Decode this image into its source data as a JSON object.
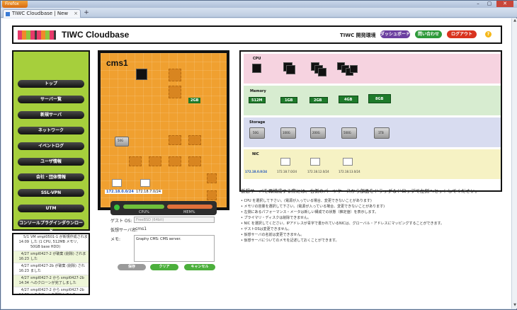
{
  "browser": {
    "app_button": "Firefox",
    "tab_title": "TIWC Cloudbase | New Server",
    "new_tab": "+",
    "controls": [
      "–",
      "▢",
      "✕"
    ]
  },
  "header": {
    "title": "TIWC Cloudbase",
    "env_label": "TIWC 開発環境",
    "buttons": [
      {
        "label": "ダッシュボード",
        "color": "#6b3fa0"
      },
      {
        "label": "問い合わせ",
        "color": "#2e9a3a"
      },
      {
        "label": "ログアウト",
        "color": "#d9331f"
      }
    ],
    "help": "?"
  },
  "nav": {
    "items": [
      "トップ",
      "サーバー覧",
      "新規サーバ",
      "ネットワーク",
      "イベントログ",
      "ユーザ情報",
      "会社・団体情報",
      "SSL-VPN",
      "UTM",
      "コンソールプラグインダウンロード"
    ]
  },
  "log": {
    "rows": [
      {
        "time": "5/1 14:09",
        "link": "smpl0501-1",
        "text": "VM smpl0501-1 が新規作成されました (1 CPU, 512MB メモリ, 50GB base HDD)"
      },
      {
        "time": "4/27 16:23",
        "link": "",
        "text": "smpl0427-2 が破棄 (削除) されました"
      },
      {
        "time": "4/27 16:23",
        "link": "",
        "text": "smpl0427-2b が破棄 (削除) されました"
      },
      {
        "time": "4/27 14:34",
        "link": "",
        "text": "smpl0427-2 から smpl0427-2b へのクローンが完了しました"
      },
      {
        "time": "4/27 14:33",
        "link": "",
        "text": "smpl0427-2 から smpl0427-2b へのクローンを開始しました"
      }
    ]
  },
  "server": {
    "name": "cms1",
    "memory_tag": "2GB",
    "disk_tag": "50G",
    "nic_ips": [
      "172.18.0.0/24",
      "172.18.7.0/24"
    ]
  },
  "meters": {
    "cpu_label": "CPU%",
    "mem_label": "MEM%",
    "cpu_color": "#6fbf3a",
    "mem_color": "#e0703a"
  },
  "form": {
    "os_label": "ゲスト OS:",
    "os_value": "FreeBSD (64bit)",
    "name_label": "仮想サーバ名:",
    "name_value": "cms1",
    "memo_label": "メモ:",
    "memo_value": "Graphy CMS: CMS server.",
    "save": "保存",
    "clear": "クリア",
    "cancel": "キャンセル"
  },
  "parts": {
    "cpu": {
      "label": "CPU",
      "color": "#f6d3e0"
    },
    "memory": {
      "label": "Memory",
      "color": "#d7ecd0",
      "sizes": [
        "512M",
        "1GB",
        "2GB",
        "4GB",
        "8GB"
      ]
    },
    "storage": {
      "label": "Storage",
      "color": "#d8dcf0",
      "sizes": [
        "50G",
        "100G",
        "200G",
        "500G",
        "1TB"
      ]
    },
    "nic": {
      "label": "NIC",
      "color": "#f6f2c4",
      "ips": [
        "172.18.0.0/24",
        "172.18.7.0/24",
        "172.18.12.0/24",
        "172.18.13.0/24"
      ]
    }
  },
  "info": {
    "title": "仮想サーバを再構成する際には、右側のパーツケースから部品をドラッグ＆ドロップで左側へセットしてください。",
    "bullets": [
      "CPU を選択して下さい。(電源が入っている場合、変更できないことがあります)",
      "メモリの容量を選択して下さい。(電源が入っている場合、変更できないことがあります)",
      "左側にあるパフォーマンス・メータは新しい構成での状態（推定値）を表示します。",
      "プライマリ・ディスクは削除できません。",
      "NIC を選択してください。IPアドレスが青字で書かれているNICは、グローバル・アドレスにマッピングすることができます。",
      "ゲストOSは変更できません。",
      "仮想サーバの名前は変更できません。",
      "仮想サーバについてのメモを記述しておくことができます。"
    ]
  }
}
